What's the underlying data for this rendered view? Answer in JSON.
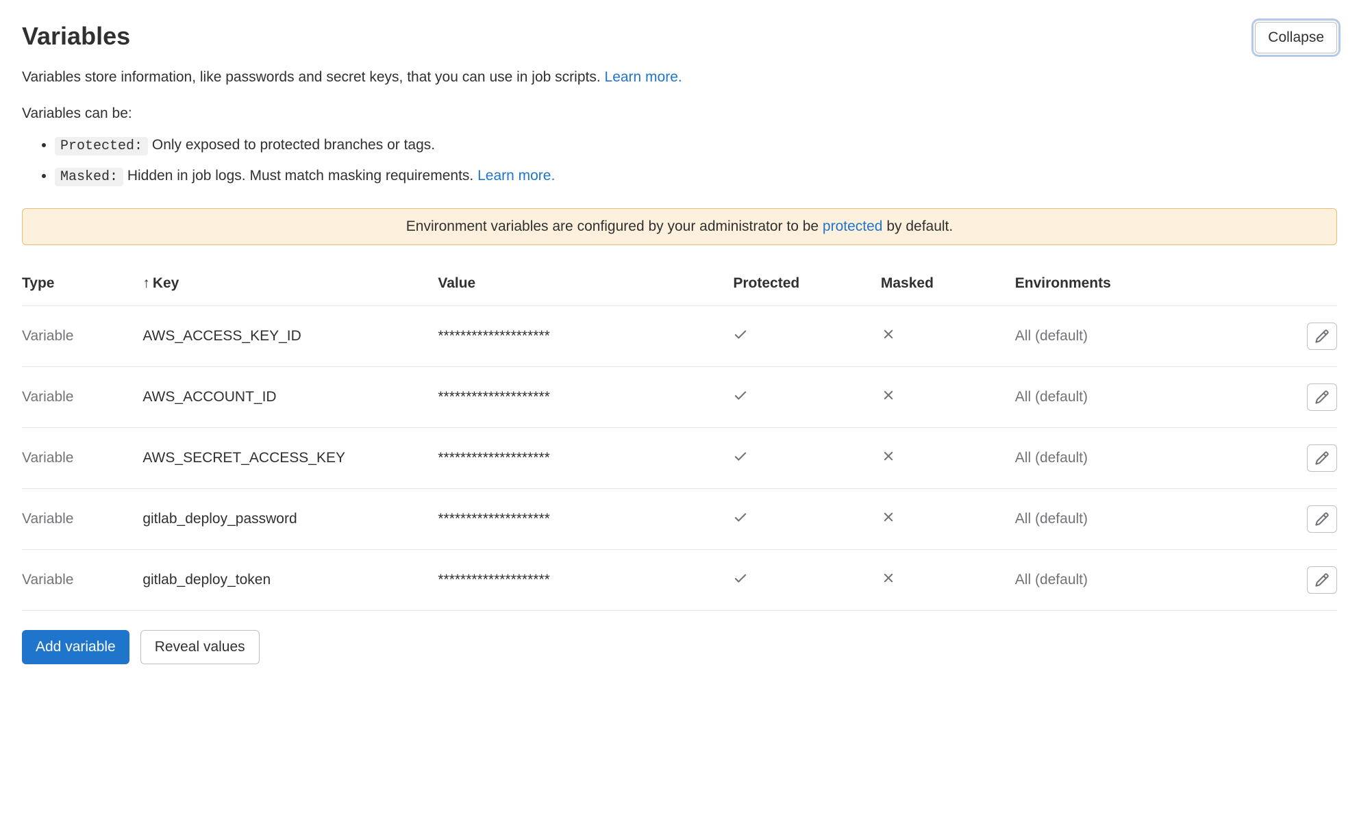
{
  "header": {
    "title": "Variables",
    "collapse_label": "Collapse"
  },
  "description": {
    "text": "Variables store information, like passwords and secret keys, that you can use in job scripts. ",
    "learn_more": "Learn more."
  },
  "can_be_heading": "Variables can be:",
  "types": {
    "protected_tag": "Protected:",
    "protected_desc": " Only exposed to protected branches or tags.",
    "masked_tag": "Masked:",
    "masked_desc": " Hidden in job logs. Must match masking requirements. ",
    "masked_learn_more": "Learn more."
  },
  "banner": {
    "prefix": "Environment variables are configured by your administrator to be ",
    "link": "protected",
    "suffix": " by default."
  },
  "table": {
    "headers": {
      "type": "Type",
      "key": "Key",
      "value": "Value",
      "protected": "Protected",
      "masked": "Masked",
      "environments": "Environments"
    },
    "sort_indicator": "↑",
    "rows": [
      {
        "type": "Variable",
        "key": "AWS_ACCESS_KEY_ID",
        "value": "********************",
        "protected": true,
        "masked": false,
        "env": "All (default)"
      },
      {
        "type": "Variable",
        "key": "AWS_ACCOUNT_ID",
        "value": "********************",
        "protected": true,
        "masked": false,
        "env": "All (default)"
      },
      {
        "type": "Variable",
        "key": "AWS_SECRET_ACCESS_KEY",
        "value": "********************",
        "protected": true,
        "masked": false,
        "env": "All (default)"
      },
      {
        "type": "Variable",
        "key": "gitlab_deploy_password",
        "value": "********************",
        "protected": true,
        "masked": false,
        "env": "All (default)"
      },
      {
        "type": "Variable",
        "key": "gitlab_deploy_token",
        "value": "********************",
        "protected": true,
        "masked": false,
        "env": "All (default)"
      }
    ]
  },
  "actions": {
    "add_variable": "Add variable",
    "reveal_values": "Reveal values"
  }
}
